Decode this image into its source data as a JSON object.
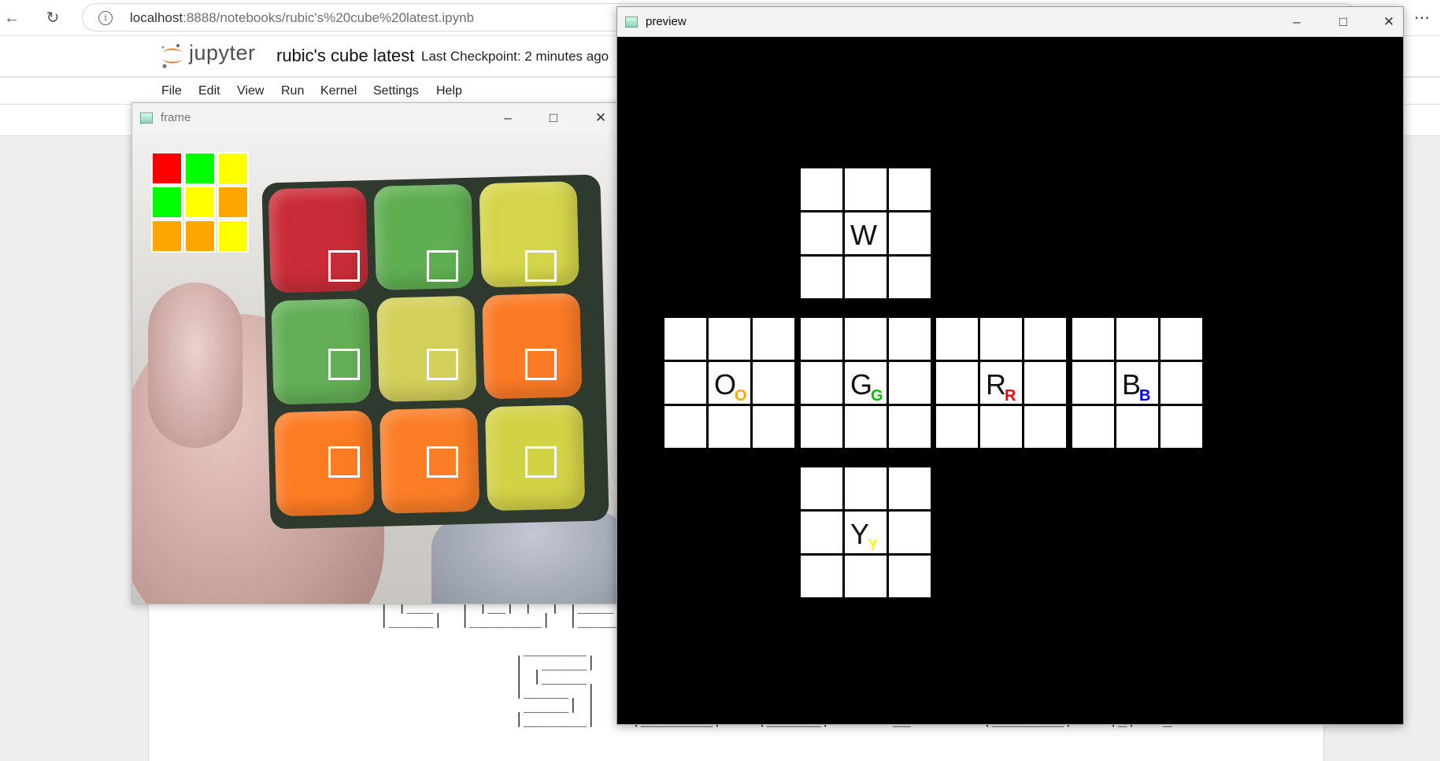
{
  "browser": {
    "back_icon": "←",
    "reload_icon": "↻",
    "url_host": "localhost",
    "url_rest": ":8888/notebooks/rubic's%20cube%20latest.ipynb",
    "more_icon": "⋯"
  },
  "jupyter": {
    "wordmark": "jupyter",
    "notebook_name": "rubic's cube latest",
    "checkpoint": "Last Checkpoint: 2 minutes ago",
    "menu": [
      "File",
      "Edit",
      "View",
      "Run",
      "Kernel",
      "Settings",
      "Help"
    ]
  },
  "frame_window": {
    "title": "frame",
    "minimize_icon": "–",
    "maximize_icon": "□",
    "close_icon": "✕",
    "detected_colors": [
      "#ff0000",
      "#00ff00",
      "#ffff00",
      "#00ff00",
      "#ffff00",
      "#ffa500",
      "#ffa500",
      "#ffa500",
      "#ffff00"
    ],
    "sticker_colors": [
      "#c92c38",
      "#5fae52",
      "#d4d54a",
      "#63ae56",
      "#d3d05a",
      "#fb7a25",
      "#fc7b23",
      "#fb7e27",
      "#d2d247"
    ]
  },
  "preview_window": {
    "title": "preview",
    "minimize_icon": "–",
    "maximize_icon": "□",
    "close_icon": "✕",
    "faces": [
      {
        "id": "top",
        "letter": "W",
        "sub": "",
        "sub_color": "#000000"
      },
      {
        "id": "left",
        "letter": "O",
        "sub": "O",
        "sub_color": "#ffa500"
      },
      {
        "id": "front",
        "letter": "G",
        "sub": "G",
        "sub_color": "#00c000"
      },
      {
        "id": "right",
        "letter": "R",
        "sub": "R",
        "sub_color": "#ff0000"
      },
      {
        "id": "back",
        "letter": "B",
        "sub": "B",
        "sub_color": "#0000ff"
      },
      {
        "id": "bottom",
        "letter": "Y",
        "sub": "Y",
        "sub_color": "#ffff00"
      }
    ]
  }
}
